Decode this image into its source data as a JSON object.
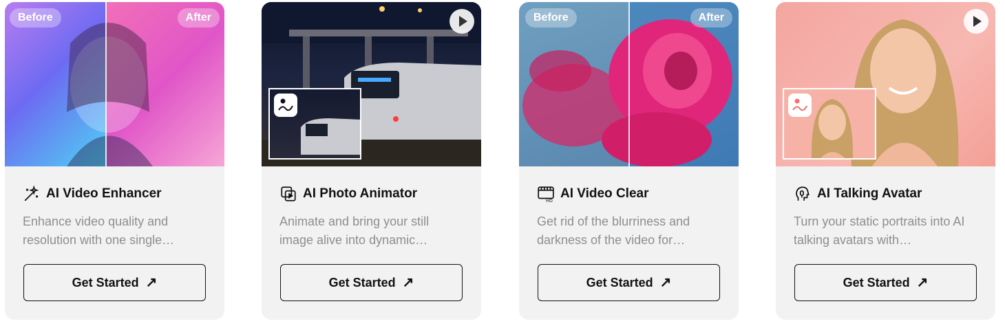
{
  "cards": [
    {
      "title": "AI Video Enhancer",
      "description": "Enhance video quality and resolution with one single…",
      "cta": "Get Started",
      "arrow": "↗",
      "before_label": "Before",
      "after_label": "After",
      "icon": "magic-wand-icon"
    },
    {
      "title": "AI Photo Animator",
      "description": "Animate and bring your still image alive into dynamic…",
      "cta": "Get Started",
      "arrow": "↗",
      "icon": "photo-animate-icon"
    },
    {
      "title": "AI Video Clear",
      "description": "Get rid of the blurriness and darkness of the video for…",
      "cta": "Get Started",
      "arrow": "↗",
      "before_label": "Before",
      "after_label": "After",
      "icon": "video-hd-icon"
    },
    {
      "title": "AI Talking Avatar",
      "description": "Turn your static portraits into AI talking avatars with…",
      "cta": "Get Started",
      "arrow": "↗",
      "icon": "talking-head-icon"
    }
  ]
}
